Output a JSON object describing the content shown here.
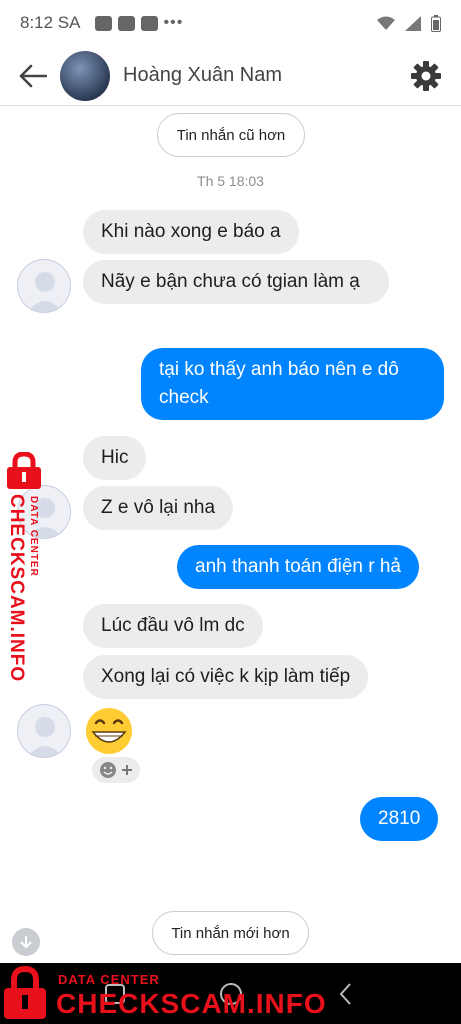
{
  "status_bar": {
    "time": "8:12 SA",
    "dots": "•••"
  },
  "header": {
    "contact_name": "Hoàng Xuân Nam",
    "back_icon": "arrow-left-icon",
    "settings_icon": "gear-icon"
  },
  "older_button": "Tin nhắn cũ hơn",
  "timestamp": "Th 5 18:03",
  "messages": [
    {
      "side": "in",
      "text": "Khi nào xong e báo a"
    },
    {
      "side": "in",
      "text": "Nãy e bận chưa có tgian làm ạ"
    },
    {
      "side": "out",
      "text": "tại ko thấy anh báo nên e dô check"
    },
    {
      "side": "in",
      "text": "Hic"
    },
    {
      "side": "in",
      "text": "Z e vô lại nha"
    },
    {
      "side": "out",
      "text": "anh thanh toán điện r hả"
    },
    {
      "side": "in",
      "text": "Lúc đầu vô lm dc"
    },
    {
      "side": "in",
      "text": "Xong lại có việc k kịp làm tiếp"
    },
    {
      "side": "in",
      "emoji": "grinning-face-icon"
    },
    {
      "side": "out",
      "text": "2810"
    }
  ],
  "newer_button": "Tin nhắn mới hơn",
  "watermark": {
    "small": "DATA CENTER",
    "big": "CHECKSCAM.INFO"
  },
  "colors": {
    "outgoing": "#0084ff",
    "incoming": "#ececec",
    "watermark": "#e8101b"
  }
}
